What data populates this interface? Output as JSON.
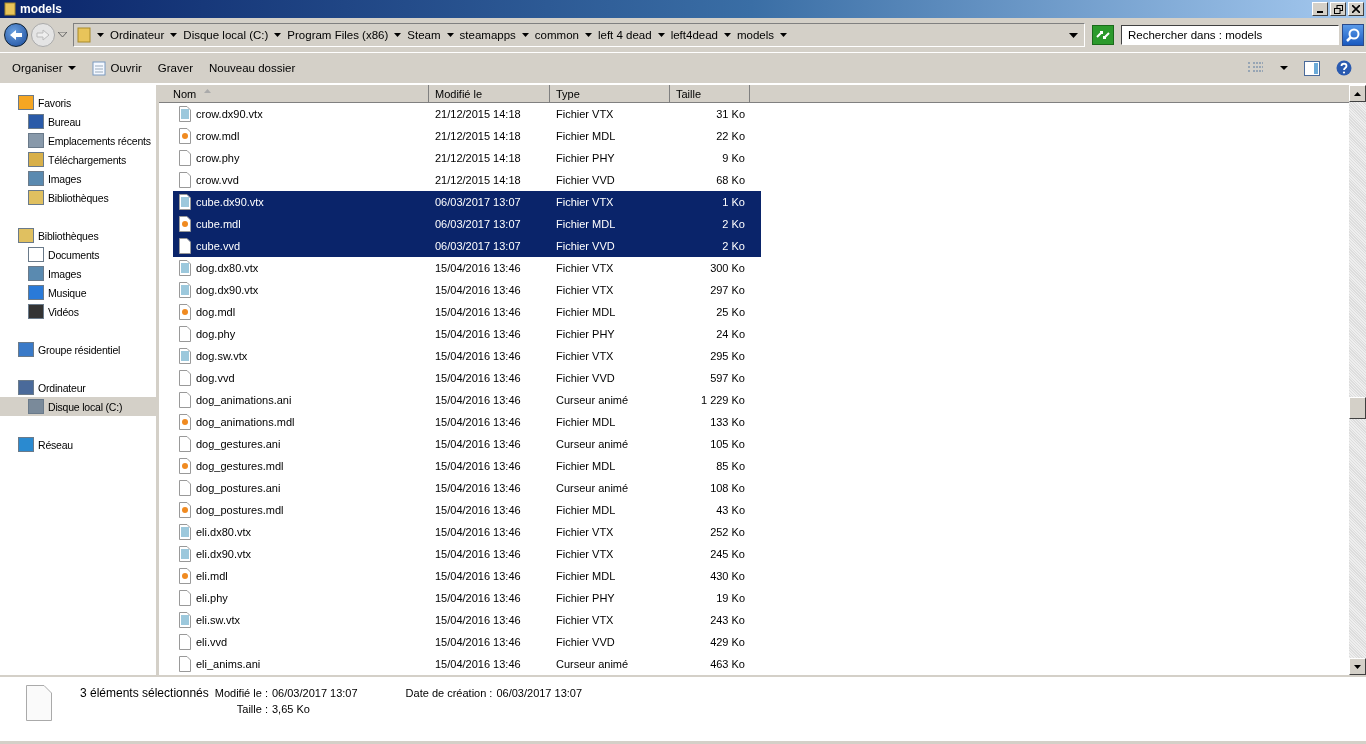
{
  "window": {
    "title": "models"
  },
  "address": {
    "crumbs": [
      "Ordinateur",
      "Disque local (C:)",
      "Program Files (x86)",
      "Steam",
      "steamapps",
      "common",
      "left 4 dead",
      "left4dead",
      "models"
    ],
    "search_placeholder": "Rechercher dans : models"
  },
  "toolbar": {
    "organise": "Organiser",
    "open": "Ouvrir",
    "burn": "Graver",
    "new_folder": "Nouveau dossier"
  },
  "sidebar": [
    {
      "label": "Favoris",
      "kind": "star",
      "selected": false,
      "children": [
        {
          "label": "Bureau",
          "kind": "desktop",
          "selected": false
        },
        {
          "label": "Emplacements récents",
          "kind": "recent",
          "selected": false
        },
        {
          "label": "Téléchargements",
          "kind": "download",
          "selected": false
        },
        {
          "label": "Images",
          "kind": "picture",
          "selected": false
        },
        {
          "label": "Bibliothèques",
          "kind": "library",
          "selected": false
        }
      ]
    },
    {
      "label": "Bibliothèques",
      "kind": "library",
      "selected": false,
      "children": [
        {
          "label": "Documents",
          "kind": "document",
          "selected": false
        },
        {
          "label": "Images",
          "kind": "picture",
          "selected": false
        },
        {
          "label": "Musique",
          "kind": "music",
          "selected": false
        },
        {
          "label": "Vidéos",
          "kind": "video",
          "selected": false
        }
      ]
    },
    {
      "label": "Groupe résidentiel",
      "kind": "homegroup",
      "selected": false
    },
    {
      "label": "Ordinateur",
      "kind": "computer",
      "selected": false,
      "children": [
        {
          "label": "Disque local (C:)",
          "kind": "drive",
          "selected": true
        }
      ]
    },
    {
      "label": "Réseau",
      "kind": "network",
      "selected": false
    }
  ],
  "table": {
    "columns": [
      "Nom",
      "Modifié le",
      "Type",
      "Taille"
    ],
    "rows": [
      {
        "name": "crow.dx90.vtx",
        "modified": "21/12/2015 14:18",
        "type": "Fichier VTX",
        "size": "31 Ko",
        "kind": "vtx",
        "selected": false
      },
      {
        "name": "crow.mdl",
        "modified": "21/12/2015 14:18",
        "type": "Fichier MDL",
        "size": "22 Ko",
        "kind": "mdl",
        "selected": false
      },
      {
        "name": "crow.phy",
        "modified": "21/12/2015 14:18",
        "type": "Fichier PHY",
        "size": "9 Ko",
        "kind": "plain",
        "selected": false
      },
      {
        "name": "crow.vvd",
        "modified": "21/12/2015 14:18",
        "type": "Fichier VVD",
        "size": "68 Ko",
        "kind": "plain",
        "selected": false
      },
      {
        "name": "cube.dx90.vtx",
        "modified": "06/03/2017 13:07",
        "type": "Fichier VTX",
        "size": "1 Ko",
        "kind": "vtx",
        "selected": true
      },
      {
        "name": "cube.mdl",
        "modified": "06/03/2017 13:07",
        "type": "Fichier MDL",
        "size": "2 Ko",
        "kind": "mdl",
        "selected": true
      },
      {
        "name": "cube.vvd",
        "modified": "06/03/2017 13:07",
        "type": "Fichier VVD",
        "size": "2 Ko",
        "kind": "plain",
        "selected": true
      },
      {
        "name": "dog.dx80.vtx",
        "modified": "15/04/2016 13:46",
        "type": "Fichier VTX",
        "size": "300 Ko",
        "kind": "vtx",
        "selected": false
      },
      {
        "name": "dog.dx90.vtx",
        "modified": "15/04/2016 13:46",
        "type": "Fichier VTX",
        "size": "297 Ko",
        "kind": "vtx",
        "selected": false
      },
      {
        "name": "dog.mdl",
        "modified": "15/04/2016 13:46",
        "type": "Fichier MDL",
        "size": "25 Ko",
        "kind": "mdl",
        "selected": false
      },
      {
        "name": "dog.phy",
        "modified": "15/04/2016 13:46",
        "type": "Fichier PHY",
        "size": "24 Ko",
        "kind": "plain",
        "selected": false
      },
      {
        "name": "dog.sw.vtx",
        "modified": "15/04/2016 13:46",
        "type": "Fichier VTX",
        "size": "295 Ko",
        "kind": "vtx",
        "selected": false
      },
      {
        "name": "dog.vvd",
        "modified": "15/04/2016 13:46",
        "type": "Fichier VVD",
        "size": "597 Ko",
        "kind": "plain",
        "selected": false
      },
      {
        "name": "dog_animations.ani",
        "modified": "15/04/2016 13:46",
        "type": "Curseur animé",
        "size": "1 229 Ko",
        "kind": "plain",
        "selected": false
      },
      {
        "name": "dog_animations.mdl",
        "modified": "15/04/2016 13:46",
        "type": "Fichier MDL",
        "size": "133 Ko",
        "kind": "mdl",
        "selected": false
      },
      {
        "name": "dog_gestures.ani",
        "modified": "15/04/2016 13:46",
        "type": "Curseur animé",
        "size": "105 Ko",
        "kind": "plain",
        "selected": false
      },
      {
        "name": "dog_gestures.mdl",
        "modified": "15/04/2016 13:46",
        "type": "Fichier MDL",
        "size": "85 Ko",
        "kind": "mdl",
        "selected": false
      },
      {
        "name": "dog_postures.ani",
        "modified": "15/04/2016 13:46",
        "type": "Curseur animé",
        "size": "108 Ko",
        "kind": "plain",
        "selected": false
      },
      {
        "name": "dog_postures.mdl",
        "modified": "15/04/2016 13:46",
        "type": "Fichier MDL",
        "size": "43 Ko",
        "kind": "mdl",
        "selected": false
      },
      {
        "name": "eli.dx80.vtx",
        "modified": "15/04/2016 13:46",
        "type": "Fichier VTX",
        "size": "252 Ko",
        "kind": "vtx",
        "selected": false
      },
      {
        "name": "eli.dx90.vtx",
        "modified": "15/04/2016 13:46",
        "type": "Fichier VTX",
        "size": "245 Ko",
        "kind": "vtx",
        "selected": false
      },
      {
        "name": "eli.mdl",
        "modified": "15/04/2016 13:46",
        "type": "Fichier MDL",
        "size": "430 Ko",
        "kind": "mdl",
        "selected": false
      },
      {
        "name": "eli.phy",
        "modified": "15/04/2016 13:46",
        "type": "Fichier PHY",
        "size": "19 Ko",
        "kind": "plain",
        "selected": false
      },
      {
        "name": "eli.sw.vtx",
        "modified": "15/04/2016 13:46",
        "type": "Fichier VTX",
        "size": "243 Ko",
        "kind": "vtx",
        "selected": false
      },
      {
        "name": "eli.vvd",
        "modified": "15/04/2016 13:46",
        "type": "Fichier VVD",
        "size": "429 Ko",
        "kind": "plain",
        "selected": false
      },
      {
        "name": "eli_anims.ani",
        "modified": "15/04/2016 13:46",
        "type": "Curseur animé",
        "size": "463 Ko",
        "kind": "plain",
        "selected": false
      }
    ]
  },
  "details": {
    "count": "3 éléments sélectionnés",
    "modified_label": "Modifié le :",
    "modified": "06/03/2017 13:07",
    "created_label": "Date de création :",
    "created": "06/03/2017 13:07",
    "size_label": "Taille :",
    "size": "3,65 Ko"
  }
}
